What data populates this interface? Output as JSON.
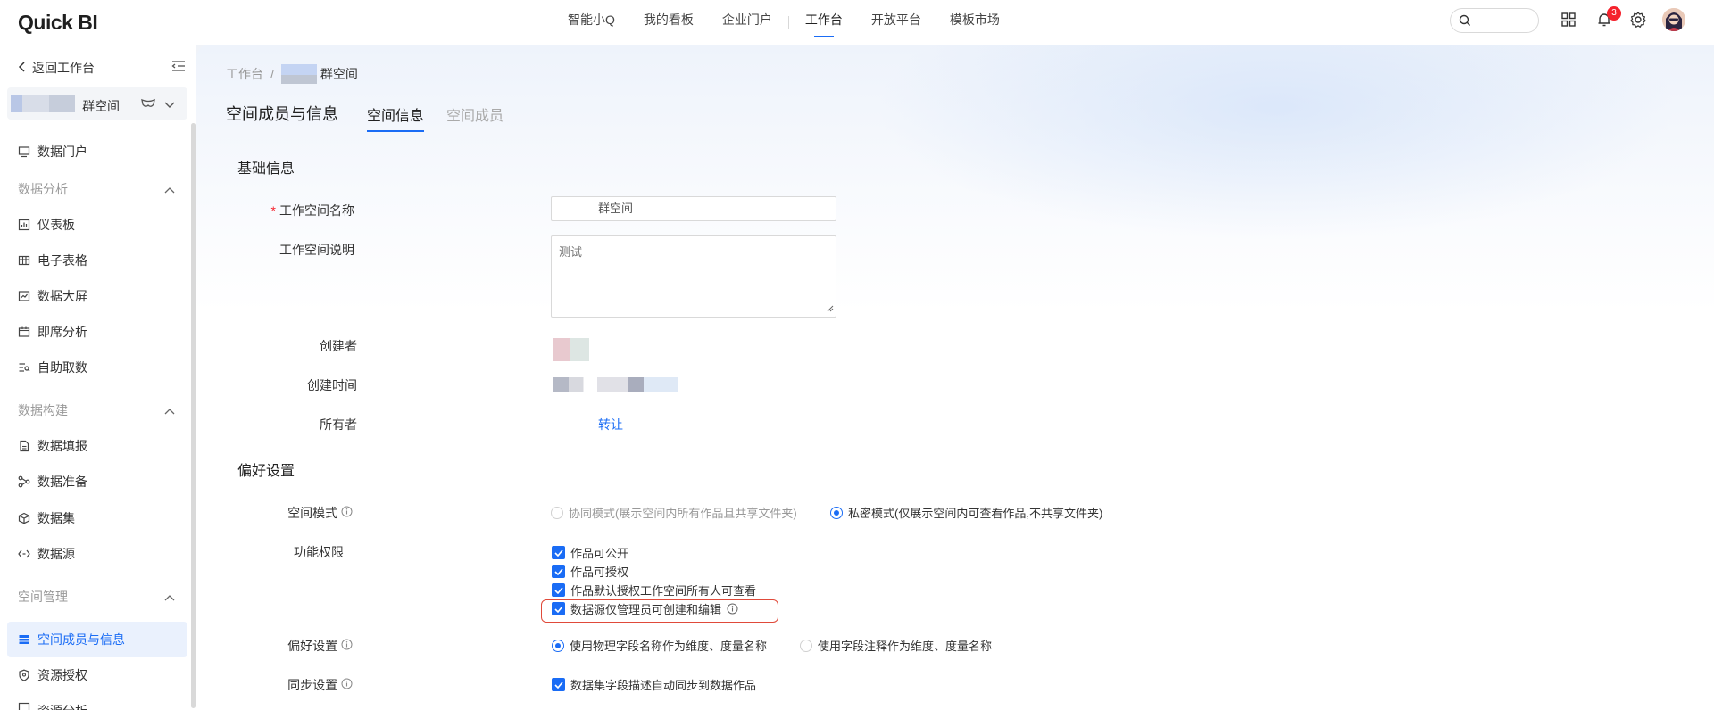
{
  "brand": {
    "logo": "Quick BI"
  },
  "topnav": {
    "items": [
      "智能小Q",
      "我的看板",
      "企业门户",
      "工作台",
      "开放平台",
      "模板市场"
    ],
    "notification_count": "3"
  },
  "sidebar": {
    "back_label": "返回工作台",
    "workspace_name": "群空间",
    "items": {
      "portal": "数据门户",
      "group_analysis": "数据分析",
      "dashboard": "仪表板",
      "spreadsheet": "电子表格",
      "screen": "数据大屏",
      "adhoc": "即席分析",
      "self_fetch": "自助取数",
      "group_build": "数据构建",
      "data_fill": "数据填报",
      "data_prep": "数据准备",
      "dataset": "数据集",
      "datasource": "数据源",
      "group_space": "空间管理",
      "members": "空间成员与信息",
      "resource_auth": "资源授权",
      "resource_analysis": "资源分析"
    }
  },
  "breadcrumb": {
    "root": "工作台",
    "sep": "/",
    "current": "群空间"
  },
  "page": {
    "title": "空间成员与信息",
    "tabs": [
      {
        "label": "空间信息"
      },
      {
        "label": "空间成员"
      }
    ]
  },
  "basic": {
    "section_title": "基础信息",
    "name_label": "工作空间名称",
    "name_required": "*",
    "name_value": "群空间",
    "desc_label": "工作空间说明",
    "desc_value": "测试",
    "creator_label": "创建者",
    "created_label": "创建时间",
    "owner_label": "所有者",
    "owner_action": "转让"
  },
  "prefs": {
    "section_title": "偏好设置",
    "mode_label": "空间模式",
    "mode_options": [
      "协同模式(展示空间内所有作品且共享文件夹)",
      "私密模式(仅展示空间内可查看作品,不共享文件夹)"
    ],
    "mode_selected": 1,
    "perm_label": "功能权限",
    "perm_options": [
      "作品可公开",
      "作品可授权",
      "作品默认授权工作空间所有人可查看",
      "数据源仅管理员可创建和编辑"
    ],
    "pref_label": "偏好设置",
    "pref_options": [
      "使用物理字段名称作为维度、度量名称",
      "使用字段注释作为维度、度量名称"
    ],
    "pref_selected": 0,
    "sync_label": "同步设置",
    "sync_option": "数据集字段描述自动同步到数据作品"
  },
  "colors": {
    "accent": "#1a6cf5",
    "highlight": "#e04a3a",
    "badge": "#f5222d"
  }
}
